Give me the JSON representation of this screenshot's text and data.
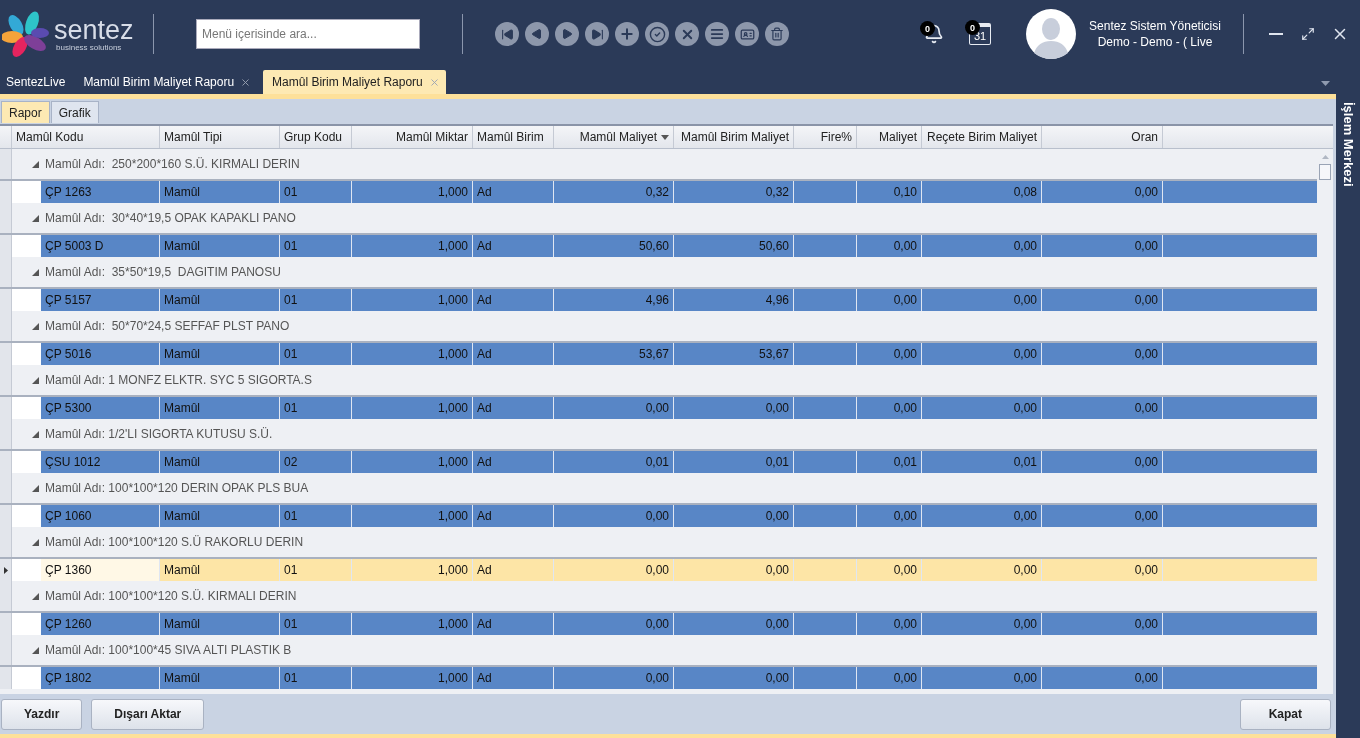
{
  "logo": {
    "name": "sentez",
    "tagline": "business solutions"
  },
  "search": {
    "placeholder": "Menü içerisinde ara..."
  },
  "toolbar": [
    {
      "kind": "first",
      "disabled": true
    },
    {
      "kind": "prev",
      "disabled": true
    },
    {
      "kind": "next",
      "disabled": true
    },
    {
      "kind": "last",
      "disabled": true
    },
    {
      "kind": "add",
      "disabled": true
    },
    {
      "kind": "confirm",
      "disabled": true
    },
    {
      "kind": "cancel",
      "disabled": true
    },
    {
      "kind": "list",
      "disabled": true
    },
    {
      "kind": "card",
      "disabled": true
    },
    {
      "kind": "delete",
      "disabled": true
    }
  ],
  "notifications": {
    "count": "0"
  },
  "calendar": {
    "count": "0",
    "day": "31"
  },
  "user": {
    "name": "Sentez Sistem Yöneticisi",
    "context": "Demo - Demo - ( Live"
  },
  "tabs": [
    {
      "label": "SentezLive",
      "selected": false,
      "closable": false
    },
    {
      "label": "Mamûl Birim Maliyet Raporu",
      "selected": false,
      "closable": true
    },
    {
      "label": "Mamûl Birim Maliyet Raporu",
      "selected": true,
      "closable": true
    }
  ],
  "subtabs": [
    {
      "label": "Rapor",
      "selected": true
    },
    {
      "label": "Grafik",
      "selected": false
    }
  ],
  "columns": [
    {
      "label": "Mamûl Kodu",
      "sorted": false
    },
    {
      "label": "Mamûl Tipi",
      "sorted": false
    },
    {
      "label": "Grup Kodu",
      "sorted": false
    },
    {
      "label": "Mamûl Miktar",
      "sorted": false
    },
    {
      "label": "Mamûl Birim",
      "sorted": false
    },
    {
      "label": "Mamûl Maliyet",
      "sorted": true
    },
    {
      "label": "Mamûl Birim Maliyet",
      "sorted": false
    },
    {
      "label": "Fire%",
      "sorted": false
    },
    {
      "label": "Maliyet",
      "sorted": false
    },
    {
      "label": "Reçete Birim Maliyet",
      "sorted": false
    },
    {
      "label": "Oran",
      "sorted": false
    }
  ],
  "groups": [
    {
      "label": "Mamûl Adı:  250*200*160 S.Ü. KIRMALI DERIN",
      "expanded": true,
      "rows": [
        {
          "focused": false,
          "cells": [
            "ÇP 1263",
            "Mamûl",
            "01",
            "1,000",
            "Ad",
            "0,32",
            "0,32",
            "",
            "0,10",
            "0,08",
            "0,00"
          ]
        }
      ]
    },
    {
      "label": "Mamûl Adı:  30*40*19,5 OPAK KAPAKLI PANO",
      "expanded": true,
      "rows": [
        {
          "focused": false,
          "cells": [
            "ÇP 5003 D",
            "Mamûl",
            "01",
            "1,000",
            "Ad",
            "50,60",
            "50,60",
            "",
            "0,00",
            "0,00",
            "0,00"
          ]
        }
      ]
    },
    {
      "label": "Mamûl Adı:  35*50*19,5  DAGITIM PANOSU",
      "expanded": true,
      "rows": [
        {
          "focused": false,
          "cells": [
            "ÇP 5157",
            "Mamûl",
            "01",
            "1,000",
            "Ad",
            "4,96",
            "4,96",
            "",
            "0,00",
            "0,00",
            "0,00"
          ]
        }
      ]
    },
    {
      "label": "Mamûl Adı:  50*70*24,5 SEFFAF PLST PANO",
      "expanded": true,
      "rows": [
        {
          "focused": false,
          "cells": [
            "ÇP 5016",
            "Mamûl",
            "01",
            "1,000",
            "Ad",
            "53,67",
            "53,67",
            "",
            "0,00",
            "0,00",
            "0,00"
          ]
        }
      ]
    },
    {
      "label": "Mamûl Adı: 1 MONFZ ELKTR. SYC 5 SIGORTA.S",
      "expanded": true,
      "rows": [
        {
          "focused": false,
          "cells": [
            "ÇP 5300",
            "Mamûl",
            "01",
            "1,000",
            "Ad",
            "0,00",
            "0,00",
            "",
            "0,00",
            "0,00",
            "0,00"
          ]
        }
      ]
    },
    {
      "label": "Mamûl Adı: 1/2'LI SIGORTA KUTUSU S.Ü.",
      "expanded": true,
      "rows": [
        {
          "focused": false,
          "cells": [
            "ÇSU 1012",
            "Mamûl",
            "02",
            "1,000",
            "Ad",
            "0,01",
            "0,01",
            "",
            "0,01",
            "0,01",
            "0,00"
          ]
        }
      ]
    },
    {
      "label": "Mamûl Adı: 100*100*120 DERIN OPAK PLS BUA",
      "expanded": true,
      "rows": [
        {
          "focused": false,
          "cells": [
            "ÇP 1060",
            "Mamûl",
            "01",
            "1,000",
            "Ad",
            "0,00",
            "0,00",
            "",
            "0,00",
            "0,00",
            "0,00"
          ]
        }
      ]
    },
    {
      "label": "Mamûl Adı: 100*100*120 S.Ü RAKORLU DERIN",
      "expanded": true,
      "rows": [
        {
          "focused": true,
          "cells": [
            "ÇP 1360",
            "Mamûl",
            "01",
            "1,000",
            "Ad",
            "0,00",
            "0,00",
            "",
            "0,00",
            "0,00",
            "0,00"
          ]
        }
      ]
    },
    {
      "label": "Mamûl Adı: 100*100*120 S.Ü. KIRMALI DERIN",
      "expanded": true,
      "rows": [
        {
          "focused": false,
          "cells": [
            "ÇP 1260",
            "Mamûl",
            "01",
            "1,000",
            "Ad",
            "0,00",
            "0,00",
            "",
            "0,00",
            "0,00",
            "0,00"
          ]
        }
      ]
    },
    {
      "label": "Mamûl Adı: 100*100*45 SIVA ALTI PLASTIK B",
      "expanded": true,
      "rows": [
        {
          "focused": false,
          "cells": [
            "ÇP 1802",
            "Mamûl",
            "01",
            "1,000",
            "Ad",
            "0,00",
            "0,00",
            "",
            "0,00",
            "0,00",
            "0,00"
          ]
        }
      ]
    }
  ],
  "footer": {
    "left": [
      "Yazdır",
      "Dışarı Aktar"
    ],
    "right": [
      "Kapat"
    ]
  },
  "side_panel": {
    "title": "İşlem Merkezi"
  }
}
